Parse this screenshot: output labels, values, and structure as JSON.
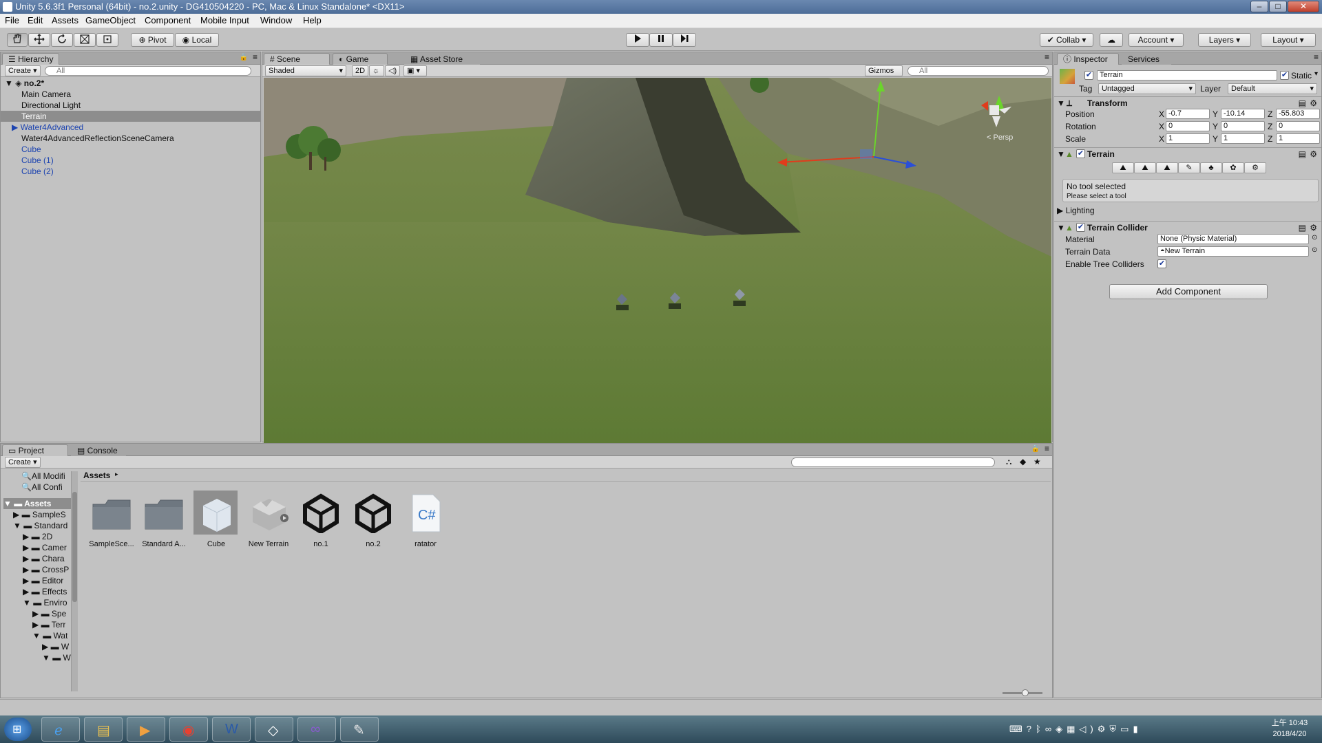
{
  "window": {
    "title": "Unity 5.6.3f1 Personal (64bit) - no.2.unity - DG410504220 - PC, Mac & Linux Standalone* <DX11>",
    "minimize": "–",
    "maximize": "□",
    "close": "✕"
  },
  "menu": [
    "File",
    "Edit",
    "Assets",
    "GameObject",
    "Component",
    "Mobile Input",
    "Window",
    "Help"
  ],
  "toolbar": {
    "pivot": "Pivot",
    "local": "Local",
    "collab": "Collab",
    "account": "Account",
    "layers": "Layers",
    "layout": "Layout"
  },
  "hierarchy": {
    "tab": "Hierarchy",
    "create": "Create",
    "search_placeholder": "All",
    "scene": "no.2*",
    "items": [
      {
        "label": "Main Camera"
      },
      {
        "label": "Directional Light"
      },
      {
        "label": "Terrain"
      },
      {
        "label": "Water4Advanced"
      },
      {
        "label": "Water4AdvancedReflectionSceneCamera"
      },
      {
        "label": "Cube"
      },
      {
        "label": "Cube (1)"
      },
      {
        "label": "Cube (2)"
      }
    ]
  },
  "scene": {
    "tabs": [
      "Scene",
      "Game",
      "Asset Store"
    ],
    "shading": "Shaded",
    "mode_2d": "2D",
    "gizmos": "Gizmos",
    "search_placeholder": "All",
    "persp": "< Persp"
  },
  "inspector": {
    "tabs": [
      "Inspector",
      "Services"
    ],
    "object_name": "Terrain",
    "static": "Static",
    "tag_label": "Tag",
    "tag": "Untagged",
    "layer_label": "Layer",
    "layer": "Default",
    "transform": {
      "title": "Transform",
      "rows": [
        {
          "label": "Position",
          "x": "-0.7",
          "y": "-10.14",
          "z": "-55.803"
        },
        {
          "label": "Rotation",
          "x": "0",
          "y": "0",
          "z": "0"
        },
        {
          "label": "Scale",
          "x": "1",
          "y": "1",
          "z": "1"
        }
      ],
      "x": "X",
      "y": "Y",
      "z": "Z"
    },
    "terrain": {
      "title": "Terrain",
      "msg1": "No tool selected",
      "msg2": "Please select a tool",
      "lighting": "Lighting"
    },
    "collider": {
      "title": "Terrain Collider",
      "material_label": "Material",
      "material": "None (Physic Material)",
      "data_label": "Terrain Data",
      "data": "New Terrain",
      "trees_label": "Enable Tree Colliders"
    },
    "add_component": "Add Component"
  },
  "project": {
    "tabs": [
      "Project",
      "Console"
    ],
    "create": "Create",
    "breadcrumb": "Assets",
    "favorites": [
      "All Modifi",
      "All Confi"
    ],
    "tree": [
      {
        "label": "Assets",
        "depth": 0
      },
      {
        "label": "SampleS",
        "depth": 1
      },
      {
        "label": "Standard",
        "depth": 1
      },
      {
        "label": "2D",
        "depth": 2
      },
      {
        "label": "Camer",
        "depth": 2
      },
      {
        "label": "Chara",
        "depth": 2
      },
      {
        "label": "CrossP",
        "depth": 2
      },
      {
        "label": "Editor",
        "depth": 2
      },
      {
        "label": "Effects",
        "depth": 2
      },
      {
        "label": "Enviro",
        "depth": 2
      },
      {
        "label": "Spe",
        "depth": 3
      },
      {
        "label": "Terr",
        "depth": 3
      },
      {
        "label": "Wat",
        "depth": 3
      },
      {
        "label": "W",
        "depth": 4
      },
      {
        "label": "W",
        "depth": 4
      }
    ],
    "assets": [
      {
        "label": "SampleSce...",
        "kind": "folder"
      },
      {
        "label": "Standard A...",
        "kind": "folder"
      },
      {
        "label": "Cube",
        "kind": "cube"
      },
      {
        "label": "New Terrain",
        "kind": "terrain"
      },
      {
        "label": "no.1",
        "kind": "unity"
      },
      {
        "label": "no.2",
        "kind": "unity"
      },
      {
        "label": "ratator",
        "kind": "script"
      }
    ]
  },
  "taskbar": {
    "clock_time": "上午 10:43",
    "clock_date": "2018/4/20",
    "apps": [
      "ie-icon",
      "explorer-icon",
      "media-player-icon",
      "chrome-icon",
      "word-icon",
      "unity-icon",
      "visual-studio-icon",
      "paint-icon"
    ]
  }
}
